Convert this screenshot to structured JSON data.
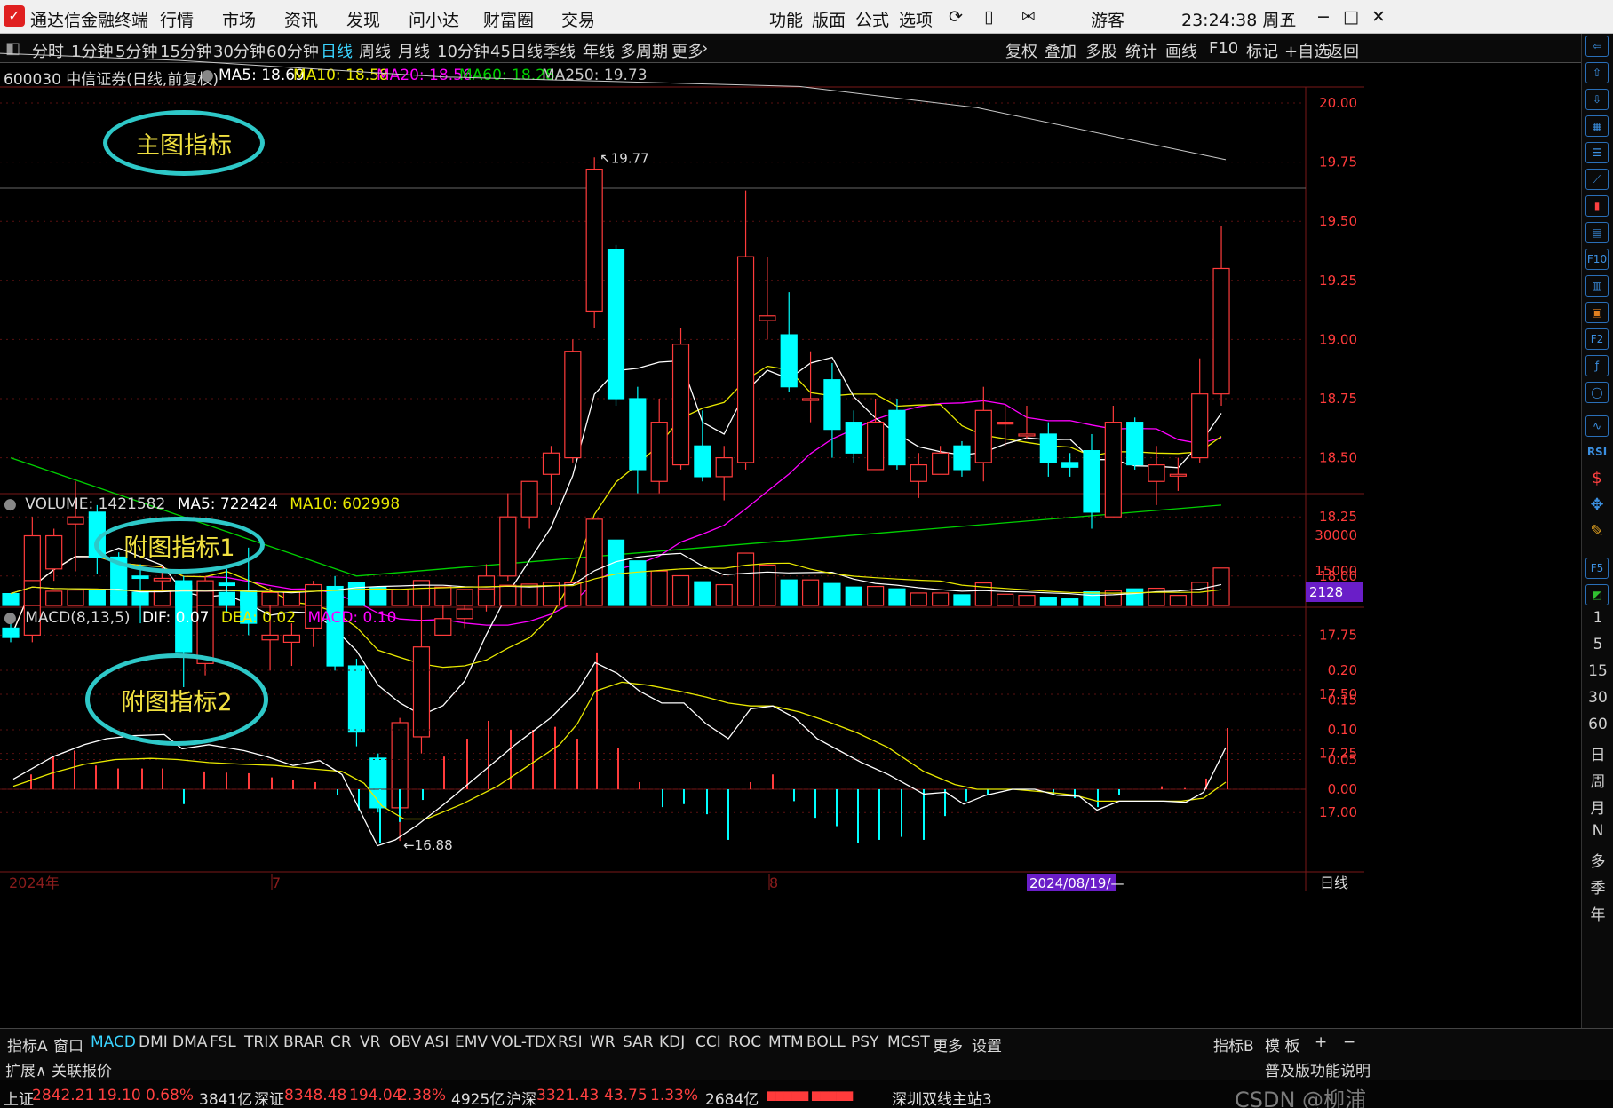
{
  "titlebar": {
    "app_title": "通达信金融终端",
    "menus": [
      "行情",
      "市场",
      "资讯",
      "发现",
      "问小达",
      "财富圈",
      "交易"
    ],
    "right_menus": [
      "功能",
      "版面",
      "公式",
      "选项"
    ],
    "user": "游客",
    "clock": "23:24:38 周五"
  },
  "periods": [
    "分时",
    "1分钟",
    "5分钟",
    "15分钟",
    "30分钟",
    "60分钟",
    "日线",
    "周线",
    "月线",
    "10分钟",
    "45日线",
    "季线",
    "年线",
    "多周期",
    "更多"
  ],
  "active_period": "日线",
  "toolbar_right": [
    "复权",
    "叠加",
    "多股",
    "统计",
    "画线",
    "F10",
    "标记",
    "+自选",
    "返回"
  ],
  "stock_info": {
    "label": "600030 中信证券(日线,前复权)",
    "ma5": "MA5: 18.69",
    "ma10": "MA10: 18.58",
    "ma20": "MA20: 18.56",
    "ma60": "MA60: 18.28",
    "ma250": "MA250: 19.73"
  },
  "colors": {
    "up": "#ff3b3b",
    "down": "#00ffff",
    "ma5": "#ffffff",
    "ma10": "#e8e800",
    "ma20": "#ff00ff",
    "ma60": "#00d000",
    "ma250": "#c8c8c8",
    "annotation": "#2ec8c8"
  },
  "annotations": {
    "main": "主图指标",
    "sub1": "附图指标1",
    "sub2": "附图指标2"
  },
  "price_axis": [
    "20.00",
    "19.75",
    "19.50",
    "19.25",
    "19.00",
    "18.75",
    "18.50",
    "18.25",
    "18.00",
    "17.75",
    "17.50",
    "17.25",
    "17.00"
  ],
  "high_label": "19.77",
  "low_label": "16.88",
  "volume_info": {
    "label": "VOLUME: 1421582",
    "ma5": "MA5: 722424",
    "ma10": "MA10: 602998",
    "axis": [
      "30000",
      "15000"
    ],
    "marker": "2128"
  },
  "macd_info": {
    "label": "MACD(8,13,5)",
    "dif": "DIF: 0.07",
    "dea": "DEA: 0.02",
    "macd": "MACD: 0.10",
    "axis": [
      "0.20",
      "0.15",
      "0.10",
      "0.05",
      "0.00"
    ]
  },
  "time_axis": {
    "year": "2024年",
    "m7": "7",
    "m8": "8",
    "cursor_date": "2024/08/19/—",
    "period": "日线"
  },
  "right_periods": [
    "1",
    "5",
    "15",
    "30",
    "60",
    "日",
    "周",
    "月",
    "N",
    "多",
    "季",
    "年"
  ],
  "right_icons": [
    "F10",
    "RSI",
    "F2",
    "F5"
  ],
  "tabs": [
    "指标A",
    "窗口",
    "MACD",
    "DMI",
    "DMA",
    "FSL",
    "TRIX",
    "BRAR",
    "CR",
    "VR",
    "OBV",
    "ASI",
    "EMV",
    "VOL-TDX",
    "RSI",
    "WR",
    "SAR",
    "KDJ",
    "CCI",
    "ROC",
    "MTM",
    "BOLL",
    "PSY",
    "MCST",
    "更多",
    "设置"
  ],
  "active_tab": "MACD",
  "tabs_right": [
    "指标B",
    "模 板",
    "+",
    "−"
  ],
  "ext": [
    "扩展∧",
    "关联报价"
  ],
  "ext_right": "普及版功能说明",
  "status": {
    "sh_label": "上证",
    "sh_value": "2842.21",
    "sh_change": "19.10",
    "sh_pct": "0.68%",
    "sh_amount": "3841亿",
    "sz_label": "深证",
    "sz_value": "8348.48",
    "sz_change": "194.04",
    "sz_pct": "2.38%",
    "sz_amount": "4925亿",
    "hs_label": "沪深",
    "hs_value": "3321.43",
    "hs_change": "43.75",
    "hs_pct": "1.33%",
    "hs_amount": "2684亿",
    "server": "深圳双线主站3",
    "watermark": "CSDN @柳浦"
  },
  "chart_data": {
    "type": "candlestick",
    "title": "600030 中信证券(日线,前复权)",
    "ylim": [
      16.8,
      20.1
    ],
    "candles": [
      {
        "o": 17.78,
        "h": 17.82,
        "l": 17.72,
        "c": 17.74
      },
      {
        "o": 17.75,
        "h": 18.25,
        "l": 17.72,
        "c": 18.17
      },
      {
        "o": 18.03,
        "h": 18.2,
        "l": 17.98,
        "c": 18.17
      },
      {
        "o": 18.22,
        "h": 18.4,
        "l": 18.02,
        "c": 18.25
      },
      {
        "o": 18.27,
        "h": 18.3,
        "l": 18.01,
        "c": 18.08
      },
      {
        "o": 18.08,
        "h": 18.1,
        "l": 17.92,
        "c": 17.92
      },
      {
        "o": 18.0,
        "h": 18.05,
        "l": 17.8,
        "c": 17.99
      },
      {
        "o": 17.98,
        "h": 18.04,
        "l": 17.93,
        "c": 17.99
      },
      {
        "o": 17.98,
        "h": 18.0,
        "l": 17.53,
        "c": 17.68
      },
      {
        "o": 17.63,
        "h": 18.0,
        "l": 17.58,
        "c": 17.98
      },
      {
        "o": 17.97,
        "h": 18.03,
        "l": 17.85,
        "c": 17.96
      },
      {
        "o": 17.94,
        "h": 18.12,
        "l": 17.75,
        "c": 17.8
      },
      {
        "o": 17.73,
        "h": 17.95,
        "l": 17.6,
        "c": 17.75
      },
      {
        "o": 17.72,
        "h": 17.8,
        "l": 17.62,
        "c": 17.75
      },
      {
        "o": 17.78,
        "h": 17.98,
        "l": 17.7,
        "c": 17.96
      },
      {
        "o": 17.92,
        "h": 18.0,
        "l": 17.6,
        "c": 17.62
      },
      {
        "o": 17.62,
        "h": 17.65,
        "l": 17.28,
        "c": 17.34
      },
      {
        "o": 17.23,
        "h": 17.25,
        "l": 17.0,
        "c": 17.02
      },
      {
        "o": 17.02,
        "h": 17.4,
        "l": 16.88,
        "c": 17.38
      },
      {
        "o": 17.32,
        "h": 17.9,
        "l": 17.25,
        "c": 17.7
      },
      {
        "o": 17.75,
        "h": 17.88,
        "l": 17.75,
        "c": 17.82
      },
      {
        "o": 17.82,
        "h": 17.92,
        "l": 17.78,
        "c": 17.86
      },
      {
        "o": 17.92,
        "h": 18.05,
        "l": 17.85,
        "c": 18.0
      },
      {
        "o": 18.0,
        "h": 18.35,
        "l": 17.98,
        "c": 18.25
      },
      {
        "o": 18.25,
        "h": 18.4,
        "l": 18.2,
        "c": 18.4
      },
      {
        "o": 18.43,
        "h": 18.55,
        "l": 18.3,
        "c": 18.52
      },
      {
        "o": 18.5,
        "h": 19.0,
        "l": 18.48,
        "c": 18.95
      },
      {
        "o": 19.12,
        "h": 19.77,
        "l": 19.05,
        "c": 19.72
      },
      {
        "o": 19.38,
        "h": 19.4,
        "l": 18.72,
        "c": 18.75
      },
      {
        "o": 18.75,
        "h": 18.8,
        "l": 18.35,
        "c": 18.45
      },
      {
        "o": 18.4,
        "h": 18.75,
        "l": 18.35,
        "c": 18.65
      },
      {
        "o": 18.47,
        "h": 19.05,
        "l": 18.45,
        "c": 18.98
      },
      {
        "o": 18.55,
        "h": 18.7,
        "l": 18.4,
        "c": 18.42
      },
      {
        "o": 18.42,
        "h": 18.55,
        "l": 18.32,
        "c": 18.5
      },
      {
        "o": 18.48,
        "h": 19.63,
        "l": 18.45,
        "c": 19.35
      },
      {
        "o": 19.08,
        "h": 19.35,
        "l": 19.0,
        "c": 19.1
      },
      {
        "o": 19.02,
        "h": 19.2,
        "l": 18.78,
        "c": 18.8
      },
      {
        "o": 18.75,
        "h": 18.95,
        "l": 18.65,
        "c": 18.75
      },
      {
        "o": 18.83,
        "h": 18.9,
        "l": 18.5,
        "c": 18.62
      },
      {
        "o": 18.65,
        "h": 18.7,
        "l": 18.48,
        "c": 18.52
      },
      {
        "o": 18.45,
        "h": 18.75,
        "l": 18.45,
        "c": 18.65
      },
      {
        "o": 18.7,
        "h": 18.75,
        "l": 18.45,
        "c": 18.47
      },
      {
        "o": 18.4,
        "h": 18.52,
        "l": 18.33,
        "c": 18.47
      },
      {
        "o": 18.43,
        "h": 18.55,
        "l": 18.43,
        "c": 18.52
      },
      {
        "o": 18.55,
        "h": 18.57,
        "l": 18.42,
        "c": 18.45
      },
      {
        "o": 18.48,
        "h": 18.8,
        "l": 18.4,
        "c": 18.7
      },
      {
        "o": 18.65,
        "h": 18.72,
        "l": 18.55,
        "c": 18.65
      },
      {
        "o": 18.6,
        "h": 18.72,
        "l": 18.58,
        "c": 18.6
      },
      {
        "o": 18.6,
        "h": 18.65,
        "l": 18.42,
        "c": 18.48
      },
      {
        "o": 18.48,
        "h": 18.52,
        "l": 18.42,
        "c": 18.46
      },
      {
        "o": 18.53,
        "h": 18.6,
        "l": 18.2,
        "c": 18.27
      },
      {
        "o": 18.25,
        "h": 18.72,
        "l": 18.25,
        "c": 18.65
      },
      {
        "o": 18.65,
        "h": 18.67,
        "l": 18.45,
        "c": 18.47
      },
      {
        "o": 18.4,
        "h": 18.55,
        "l": 18.3,
        "c": 18.47
      },
      {
        "o": 18.43,
        "h": 18.5,
        "l": 18.36,
        "c": 18.43
      },
      {
        "o": 18.5,
        "h": 18.92,
        "l": 18.48,
        "c": 18.77
      },
      {
        "o": 18.77,
        "h": 19.48,
        "l": 18.72,
        "c": 19.3
      }
    ],
    "volume": [
      2,
      4.2,
      2.4,
      2.6,
      2.6,
      1.7,
      2.2,
      2.5,
      3.3,
      2.4,
      2.2,
      1.6,
      2.2,
      2.3,
      3.5,
      3.2,
      3.9,
      3.1,
      2.7,
      4.2,
      3.1,
      2.7,
      2.8,
      3.4,
      3.6,
      3.9,
      3.8,
      14.5,
      11,
      7.5,
      5.8,
      5,
      4,
      3.5,
      8.8,
      6.8,
      4.3,
      4.3,
      3.7,
      3.1,
      3.2,
      2.8,
      2.1,
      2.1,
      1.8,
      3.8,
      1.9,
      1.7,
      1.4,
      1.1,
      2.3,
      2.5,
      2.8,
      2.9,
      1.7,
      3.9,
      6.3
    ],
    "dif_points": [
      [
        15,
        0.017
      ],
      [
        60,
        0.055
      ],
      [
        95,
        0.075
      ],
      [
        120,
        0.085
      ],
      [
        150,
        0.09
      ],
      [
        185,
        0.092
      ],
      [
        205,
        0.068
      ],
      [
        235,
        0.075
      ],
      [
        275,
        0.065
      ],
      [
        300,
        0.055
      ],
      [
        330,
        0.04
      ],
      [
        360,
        0.048
      ],
      [
        385,
        0.025
      ],
      [
        405,
        -0.035
      ],
      [
        425,
        -0.095
      ],
      [
        445,
        -0.085
      ],
      [
        470,
        -0.06
      ],
      [
        500,
        -0.025
      ],
      [
        540,
        0.025
      ],
      [
        580,
        0.075
      ],
      [
        620,
        0.12
      ],
      [
        650,
        0.165
      ],
      [
        670,
        0.213
      ],
      [
        695,
        0.195
      ],
      [
        720,
        0.165
      ],
      [
        745,
        0.145
      ],
      [
        770,
        0.145
      ],
      [
        795,
        0.11
      ],
      [
        820,
        0.085
      ],
      [
        845,
        0.135
      ],
      [
        870,
        0.14
      ],
      [
        895,
        0.12
      ],
      [
        920,
        0.085
      ],
      [
        945,
        0.065
      ],
      [
        970,
        0.045
      ],
      [
        1000,
        0.025
      ],
      [
        1040,
        -0.008
      ],
      [
        1065,
        -0.005
      ],
      [
        1085,
        -0.025
      ],
      [
        1110,
        -0.01
      ],
      [
        1140,
        0
      ],
      [
        1165,
        0
      ],
      [
        1190,
        -0.01
      ],
      [
        1215,
        -0.012
      ],
      [
        1235,
        -0.035
      ],
      [
        1260,
        -0.02
      ],
      [
        1285,
        -0.02
      ],
      [
        1310,
        -0.02
      ],
      [
        1335,
        -0.022
      ],
      [
        1355,
        -0.005
      ],
      [
        1380,
        0.07
      ]
    ],
    "dea_points": [
      [
        15,
        0.005
      ],
      [
        60,
        0.028
      ],
      [
        95,
        0.042
      ],
      [
        130,
        0.05
      ],
      [
        170,
        0.052
      ],
      [
        200,
        0.05
      ],
      [
        235,
        0.045
      ],
      [
        275,
        0.042
      ],
      [
        310,
        0.04
      ],
      [
        345,
        0.035
      ],
      [
        385,
        0.03
      ],
      [
        410,
        0.01
      ],
      [
        430,
        -0.028
      ],
      [
        455,
        -0.05
      ],
      [
        480,
        -0.05
      ],
      [
        520,
        -0.025
      ],
      [
        560,
        0.005
      ],
      [
        600,
        0.045
      ],
      [
        630,
        0.075
      ],
      [
        650,
        0.11
      ],
      [
        670,
        0.165
      ],
      [
        700,
        0.18
      ],
      [
        730,
        0.175
      ],
      [
        765,
        0.165
      ],
      [
        795,
        0.155
      ],
      [
        820,
        0.145
      ],
      [
        845,
        0.14
      ],
      [
        870,
        0.14
      ],
      [
        900,
        0.13
      ],
      [
        930,
        0.115
      ],
      [
        965,
        0.095
      ],
      [
        1000,
        0.07
      ],
      [
        1040,
        0.03
      ],
      [
        1075,
        0.008
      ],
      [
        1100,
        0
      ],
      [
        1140,
        0
      ],
      [
        1180,
        -0.005
      ],
      [
        1210,
        -0.01
      ],
      [
        1235,
        -0.02
      ],
      [
        1260,
        -0.02
      ],
      [
        1300,
        -0.02
      ],
      [
        1330,
        -0.02
      ],
      [
        1355,
        -0.015
      ],
      [
        1380,
        0.012
      ]
    ],
    "macd_bars": [
      [
        35,
        0.025
      ],
      [
        60,
        0.055
      ],
      [
        84,
        0.065
      ],
      [
        108,
        0.04
      ],
      [
        133,
        0.035
      ],
      [
        160,
        0.035
      ],
      [
        183,
        0.035
      ],
      [
        207,
        -0.025
      ],
      [
        230,
        0.03
      ],
      [
        255,
        0.028
      ],
      [
        280,
        0.027
      ],
      [
        306,
        0.02
      ],
      [
        330,
        0.015
      ],
      [
        355,
        0.012
      ],
      [
        380,
        -0.01
      ],
      [
        404,
        -0.035
      ],
      [
        428,
        -0.09
      ],
      [
        450,
        -0.055
      ],
      [
        476,
        -0.018
      ],
      [
        500,
        0.055
      ],
      [
        526,
        0.085
      ],
      [
        550,
        0.115
      ],
      [
        575,
        0.1
      ],
      [
        600,
        0.1
      ],
      [
        625,
        0.105
      ],
      [
        650,
        0.085
      ],
      [
        672,
        0.23
      ],
      [
        696,
        0.07
      ],
      [
        720,
        0.012
      ],
      [
        746,
        -0.03
      ],
      [
        770,
        -0.025
      ],
      [
        796,
        -0.042
      ],
      [
        820,
        -0.085
      ],
      [
        845,
        0.012
      ],
      [
        870,
        0.025
      ],
      [
        894,
        -0.02
      ],
      [
        918,
        -0.048
      ],
      [
        942,
        -0.062
      ],
      [
        966,
        -0.09
      ],
      [
        990,
        -0.085
      ],
      [
        1015,
        -0.08
      ],
      [
        1040,
        -0.085
      ],
      [
        1064,
        -0.045
      ],
      [
        1088,
        -0.02
      ],
      [
        1112,
        -0.01
      ],
      [
        1138,
        0
      ],
      [
        1162,
        0
      ],
      [
        1186,
        -0.01
      ],
      [
        1210,
        -0.015
      ],
      [
        1236,
        -0.03
      ],
      [
        1260,
        -0.01
      ],
      [
        1285,
        0
      ],
      [
        1308,
        0.005
      ],
      [
        1334,
        0.002
      ],
      [
        1358,
        0.018
      ],
      [
        1382,
        0.103
      ]
    ],
    "ma250_points": [
      [
        0,
        20.21
      ],
      [
        200,
        20.18
      ],
      [
        500,
        20.11
      ],
      [
        900,
        20.07
      ],
      [
        1100,
        19.98
      ],
      [
        1380,
        19.76
      ]
    ]
  }
}
